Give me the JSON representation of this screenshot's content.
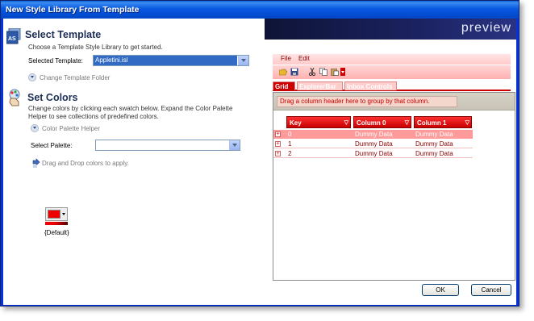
{
  "window": {
    "title": "New Style Library From Template"
  },
  "select_template": {
    "title": "Select Template",
    "icon": "stylelibrary-icon",
    "description": "Choose a Template Style Library to get started.",
    "label": "Selected Template:",
    "value": "Appletini.isl",
    "change_folder": "Change Template Folder"
  },
  "set_colors": {
    "title": "Set Colors",
    "icon": "palette-hand-icon",
    "description_line1": "Change colors by clicking each swatch below. Expand the Color Palette",
    "description_line2": "Helper to see collections of predefined colors.",
    "palette_helper": "Color Palette Helper",
    "select_palette_label": "Select Palette:",
    "select_palette_value": "",
    "drag_hint": "Drag and Drop colors to apply.",
    "swatch_label": "{Default}",
    "swatch_color": "#ee0000"
  },
  "preview": {
    "banner": "preview",
    "menu": [
      "File",
      "Edit"
    ],
    "toolbar_icons": [
      "open-folder-icon",
      "save-icon",
      "cut-icon",
      "copy-icon",
      "paste-icon",
      "dropdown-icon"
    ],
    "tabs": [
      "Grid",
      "ExplorerBar",
      "Inbox Controls"
    ],
    "group_by_text": "Drag a column header here to group by that column.",
    "columns": [
      "Key",
      "Column 0",
      "Column 1"
    ],
    "rows": [
      [
        "0",
        "Dummy Data",
        "Dummy Data"
      ],
      [
        "1",
        "Dummy Data",
        "Dummy Data"
      ],
      [
        "2",
        "Dummy Data",
        "Dummy Data"
      ]
    ]
  },
  "buttons": {
    "ok": "OK",
    "cancel": "Cancel"
  },
  "colors": {
    "accent": "#cc0000",
    "title_bar": "#0858e0",
    "preview_banner": "#1b2260"
  }
}
